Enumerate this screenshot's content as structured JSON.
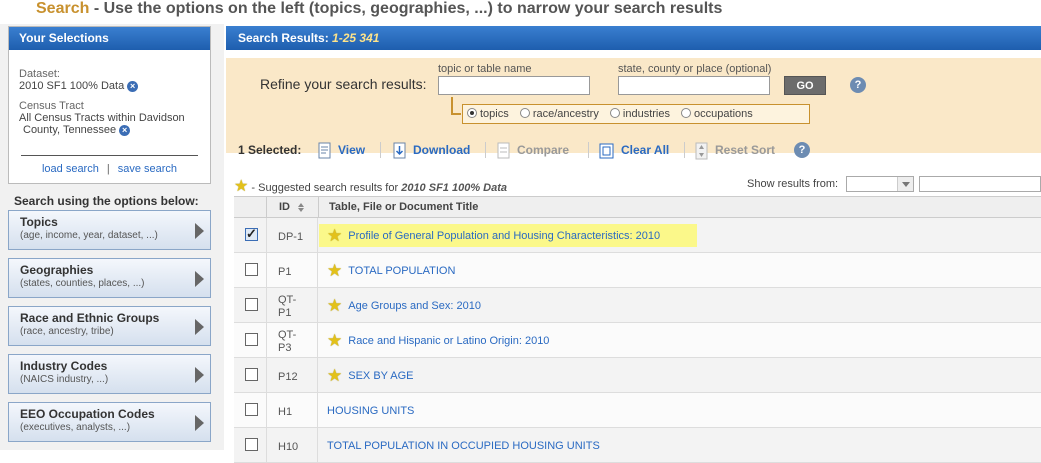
{
  "header": {
    "title_accent": "Search",
    "title_rest": " - Use the options on the left (topics, geographies, ...) to narrow your search results"
  },
  "selections": {
    "heading": "Your Selections",
    "dataset_label": "Dataset:",
    "dataset_value": "2010 SF1 100% Data",
    "tract_label": "Census Tract",
    "tract_value_1": "All Census Tracts within Davidson",
    "tract_value_2": "County, Tennessee",
    "load_search": "load search",
    "separator": "|",
    "save_search": "save search"
  },
  "search_options": {
    "heading": "Search using the options below:",
    "categories": [
      {
        "title": "Topics",
        "sub": "(age, income, year, dataset, ...)"
      },
      {
        "title": "Geographies",
        "sub": "(states, counties, places, ...)"
      },
      {
        "title": "Race and Ethnic Groups",
        "sub": "(race, ancestry, tribe)"
      },
      {
        "title": "Industry Codes",
        "sub": "(NAICS industry, ...)"
      },
      {
        "title": "EEO Occupation Codes",
        "sub": "(executives, analysts, ...)"
      }
    ]
  },
  "results": {
    "heading": "Search Results:",
    "range": "1-25 341",
    "refine_label": "Refine your search results:",
    "topic_label": "topic or table name",
    "topic_value": "",
    "geo_label": "state, county or place (optional)",
    "geo_value": "",
    "go_label": "GO",
    "help_glyph": "?",
    "radios": [
      {
        "label": "topics",
        "selected": true
      },
      {
        "label": "race/ancestry",
        "selected": false
      },
      {
        "label": "industries",
        "selected": false
      },
      {
        "label": "occupations",
        "selected": false
      }
    ]
  },
  "toolbar": {
    "selected": "1 Selected:",
    "view": "View",
    "download": "Download",
    "compare": "Compare",
    "clear_all": "Clear All",
    "reset_sort": "Reset Sort"
  },
  "suggest": {
    "prefix": "- Suggested search results for ",
    "dataset": "2010 SF1 100% Data",
    "show_from": "Show results from:"
  },
  "table": {
    "col_id": "ID",
    "col_title": "Table, File or Document Title",
    "rows": [
      {
        "id": "DP-1",
        "title": "Profile of General Population and Housing Characteristics: 2010",
        "checked": true,
        "star": true,
        "highlight": true
      },
      {
        "id": "P1",
        "title": "TOTAL POPULATION",
        "checked": false,
        "star": true,
        "highlight": false
      },
      {
        "id": "QT-P1",
        "id_line1": "QT-",
        "id_line2": "P1",
        "title": "Age Groups and Sex: 2010",
        "checked": false,
        "star": true,
        "highlight": false
      },
      {
        "id": "QT-P3",
        "id_line1": "QT-",
        "id_line2": "P3",
        "title": "Race and Hispanic or Latino Origin: 2010",
        "checked": false,
        "star": true,
        "highlight": false
      },
      {
        "id": "P12",
        "title": "SEX BY AGE",
        "checked": false,
        "star": true,
        "highlight": false
      },
      {
        "id": "H1",
        "title": "HOUSING UNITS",
        "checked": false,
        "star": false,
        "highlight": false
      },
      {
        "id": "H10",
        "title": "TOTAL POPULATION IN OCCUPIED HOUSING UNITS",
        "checked": false,
        "star": false,
        "highlight": false
      }
    ]
  }
}
